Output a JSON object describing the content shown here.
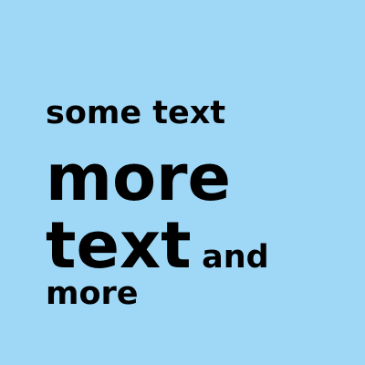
{
  "content": {
    "line1": "some text",
    "line2": "more",
    "line3_large": "text",
    "line3_small": "and",
    "line4": "more"
  },
  "colors": {
    "background": "#9fd8f6",
    "text": "#000000"
  }
}
